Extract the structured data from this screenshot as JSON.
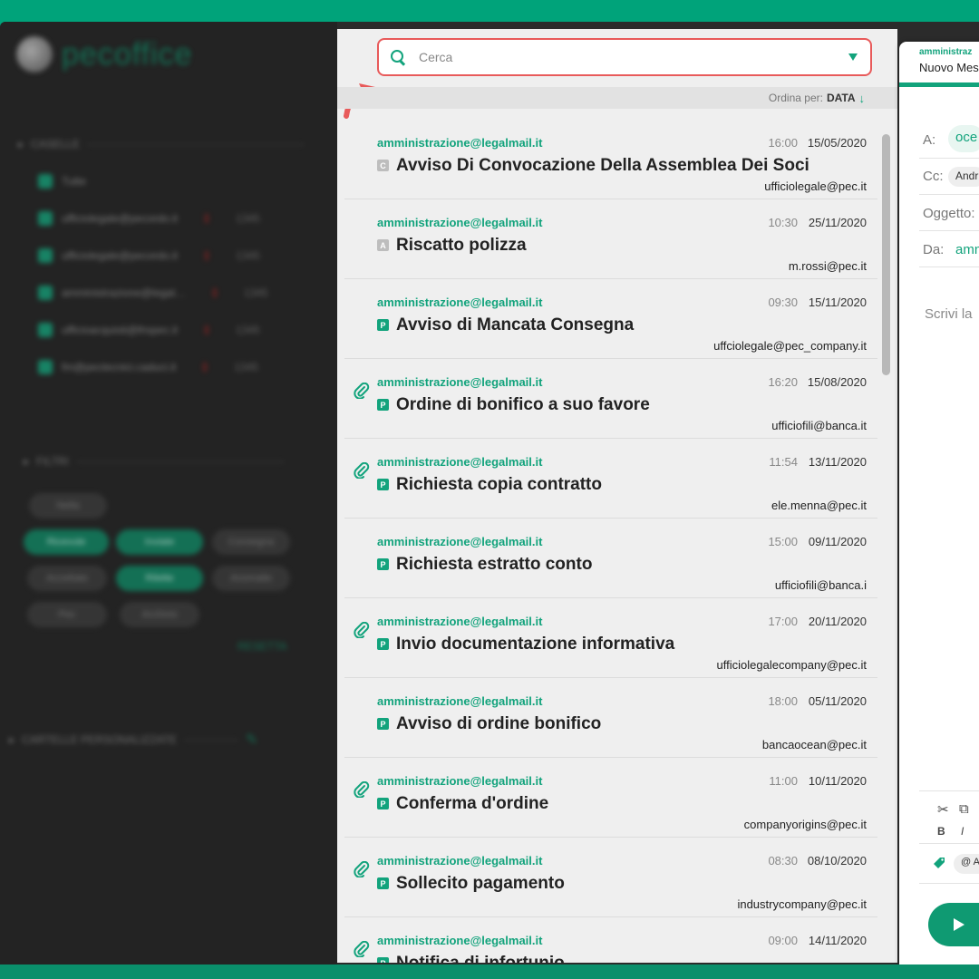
{
  "sidebar": {
    "logo_text": "pecoffice",
    "caselle_label": "CASELLE",
    "mailboxes": [
      {
        "label": "Tutte",
        "count": ""
      },
      {
        "label": "ufficiolegale@pecordo.it",
        "count": "1345"
      },
      {
        "label": "ufficiolegale@pecordo.it",
        "count": "1345"
      },
      {
        "label": "amministrazione@legal…",
        "count": "1345"
      },
      {
        "label": "ufficioacquisti@lhspec.it",
        "count": "1345"
      },
      {
        "label": "fm@pectecnici.caduci.it",
        "count": "1345"
      }
    ],
    "filtri_label": "FILTRI",
    "filter_chips": [
      "Nella",
      "Ricevute",
      "Inviate",
      "Consegna",
      "Accettate",
      "Rilette",
      "Anomalie",
      "Pec",
      "Archivio"
    ],
    "reset_label": "RESETTA",
    "custom_folders_label": "CARTELLE PERSONALIZZATE"
  },
  "search": {
    "placeholder": "Cerca",
    "value": ""
  },
  "sort": {
    "label": "Ordina per:",
    "value": "DATA",
    "arrow": "↓"
  },
  "messages": [
    {
      "from": "amministrazione@legalmail.it",
      "time": "16:00",
      "date": "15/05/2020",
      "type": "C",
      "subject": "Avviso Di Convocazione Della Assemblea Dei Soci",
      "to": "ufficiolegale@pec.it",
      "attachment": false
    },
    {
      "from": "amministrazione@legalmail.it",
      "time": "10:30",
      "date": "25/11/2020",
      "type": "A",
      "subject": "Riscatto polizza",
      "to": "m.rossi@pec.it",
      "attachment": false
    },
    {
      "from": "amministrazione@legalmail.it",
      "time": "09:30",
      "date": "15/11/2020",
      "type": "P",
      "subject": "Avviso di Mancata Consegna",
      "to": "uffciolegale@pec_company.it",
      "attachment": false
    },
    {
      "from": "amministrazione@legalmail.it",
      "time": "16:20",
      "date": "15/08/2020",
      "type": "P",
      "subject": "Ordine di bonifico a suo favore",
      "to": "ufficiofili@banca.it",
      "attachment": true
    },
    {
      "from": "amministrazione@legalmail.it",
      "time": "11:54",
      "date": "13/11/2020",
      "type": "P",
      "subject": "Richiesta copia contratto",
      "to": "ele.menna@pec.it",
      "attachment": true
    },
    {
      "from": "amministrazione@legalmail.it",
      "time": "15:00",
      "date": "09/11/2020",
      "type": "P",
      "subject": "Richiesta estratto conto",
      "to": "ufficiofili@banca.i",
      "attachment": false
    },
    {
      "from": "amministrazione@legalmail.it",
      "time": "17:00",
      "date": "20/11/2020",
      "type": "P",
      "subject": "Invio documentazione informativa",
      "to": "ufficiolegalecompany@pec.it",
      "attachment": true
    },
    {
      "from": "amministrazione@legalmail.it",
      "time": "18:00",
      "date": "05/11/2020",
      "type": "P",
      "subject": "Avviso di ordine bonifico",
      "to": "bancaocean@pec.it",
      "attachment": false
    },
    {
      "from": "amministrazione@legalmail.it",
      "time": "11:00",
      "date": "10/11/2020",
      "type": "P",
      "subject": "Conferma d'ordine",
      "to": "companyorigins@pec.it",
      "attachment": true
    },
    {
      "from": "amministrazione@legalmail.it",
      "time": "08:30",
      "date": "08/10/2020",
      "type": "P",
      "subject": "Sollecito pagamento",
      "to": "industrycompany@pec.it",
      "attachment": true
    },
    {
      "from": "amministrazione@legalmail.it",
      "time": "09:00",
      "date": "14/11/2020",
      "type": "P",
      "subject": "Notifica di infortunio",
      "to": "",
      "attachment": true
    }
  ],
  "compose": {
    "from_header": "amministraz",
    "title": "Nuovo Mes",
    "to_label": "A:",
    "to_value": "oce",
    "cc_label": "Cc:",
    "cc_value": "Andr",
    "subject_label": "Oggetto:",
    "from_label": "Da:",
    "from_value": "amn",
    "body_placeholder": "Scrivi la",
    "tool_cut": "✂",
    "tool_copy": "⧉",
    "tool_bold": "B",
    "tool_italic": "I",
    "chip_at": "@",
    "chip_text": "A"
  },
  "colors": {
    "accent": "#12a37c",
    "highlight": "#e85a5a",
    "background": "#00a37a"
  }
}
